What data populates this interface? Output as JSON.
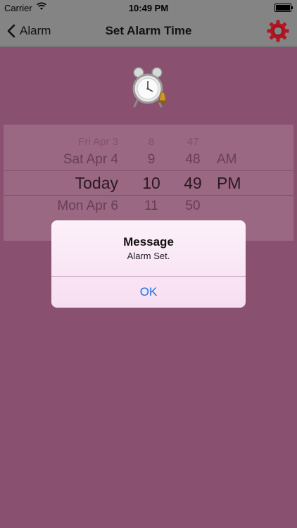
{
  "status_bar": {
    "carrier": "Carrier",
    "time": "10:49 PM"
  },
  "nav_bar": {
    "back_label": "Alarm",
    "title": "Set Alarm Time"
  },
  "picker": {
    "rows": [
      {
        "day": "Fri Apr 3",
        "hour": "8",
        "minute": "47",
        "ampm": ""
      },
      {
        "day": "Sat Apr 4",
        "hour": "9",
        "minute": "48",
        "ampm": "AM"
      },
      {
        "day": "Today",
        "hour": "10",
        "minute": "49",
        "ampm": "PM"
      },
      {
        "day": "Mon Apr 6",
        "hour": "11",
        "minute": "50",
        "ampm": ""
      }
    ]
  },
  "alert": {
    "title": "Message",
    "message": "Alarm Set.",
    "ok_label": "OK"
  },
  "colors": {
    "background": "#8a506f",
    "bar": "#848484",
    "gear": "#b3141f",
    "alert_button": "#1a6fdc"
  }
}
